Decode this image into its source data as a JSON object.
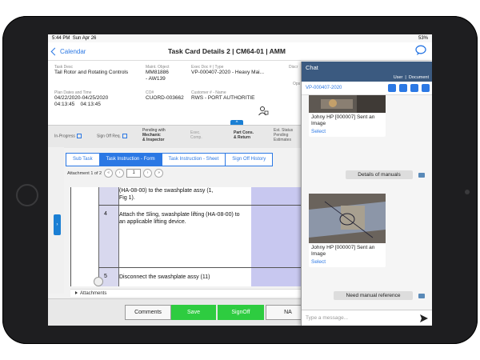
{
  "statusbar": {
    "time": "5:44 PM",
    "date": "Sun Apr 26",
    "battery": "53%"
  },
  "nav": {
    "back_label": "Calendar",
    "title": "Task Card Details  2 | CM64-01 | AMM"
  },
  "info": {
    "task_desc_label": "Task Desc",
    "task_desc": "Tail Rotor and Rotating Controls",
    "maint_object_label": "Maint. Object",
    "maint_object_1": "MM81886",
    "maint_object_2": "- AW139",
    "exec_doc_label": "Exec Doc # | Type",
    "exec_doc": "VP-000407-2020 - Heavy Mai...",
    "disc_label": "Discr",
    "ops_label": "Ops",
    "plan_dates_label": "Plan Dates and Time",
    "plan_dates": "04/22/2020-04/25/2020",
    "plan_time_1": "04:13:45",
    "plan_time_2": "04:13:45",
    "co_label": "CO#",
    "co_value": "CUORD-003662",
    "customer_label": "Customer # - Name",
    "customer_value": "RWS - PORT AUTHORITIE",
    "up_arrow": "^"
  },
  "pipeline": {
    "in_progress": "In-Progress",
    "signoff_req": "Sign Off Req.",
    "pending_with_label": "Pending with",
    "pending_with_1": "Mechanic",
    "pending_with_2": "& Inspector",
    "exec_comp_1": "Exec.",
    "exec_comp_2": "Comp.",
    "part_cons_1": "Part Cons.",
    "part_cons_2": "& Return",
    "est_status": "Est. Status",
    "est_pending_1": "Pending",
    "est_pending_2": "Estimates"
  },
  "subtabs": [
    "Sub Task",
    "Task Instruction - Form",
    "Task Instruction - Sheet",
    "Sign Off History"
  ],
  "attach": {
    "label": "Attachment 1 of 2",
    "page": "1"
  },
  "steps": {
    "step_prev_text_1": "(HA-08-00) to the swashplate assy (1,",
    "step_prev_text_2": "Fig 1).",
    "step4_num": "4",
    "step4_text": "Attach the Sling, swashplate lifting (HA-08-00) to an applicable lifting device.",
    "step5_num": "5",
    "step5_text": "Disconnect the swashplate assy (11)"
  },
  "attachments_label": "Attachments",
  "bottom": {
    "comments": "Comments",
    "save": "Save",
    "signoff": "SignOff",
    "na": "NA"
  },
  "chat": {
    "title": "Chat",
    "user": "User",
    "sep": "|",
    "document": "Document",
    "ref": "VP-000407-2020",
    "msg1_text": "Johny HP [000007] Sent an Image",
    "msg1_select": "Select",
    "reply1": "Details of manuals",
    "msg2_text": "Johny HP [000007] Sent an Image",
    "msg2_select": "Select",
    "reply2": "Need manual reference",
    "input_placeholder": "Type a message..."
  },
  "colors": {
    "accent": "#2b78e4",
    "save_green": "#2ecc40",
    "chat_header": "#3b5a80"
  }
}
